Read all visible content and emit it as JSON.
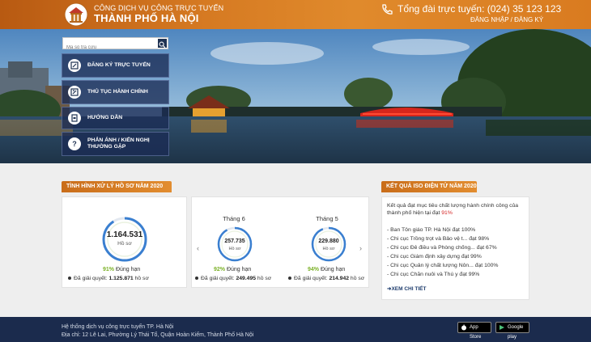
{
  "header": {
    "brand_top": "CÔNG DỊCH VỤ CÔNG TRỰC TUYẾN",
    "brand_main": "THÀNH PHỐ HÀ NỘI",
    "hotline": "Tổng đài trực tuyến: (024) 35 123 123",
    "login": "ĐĂNG NHẬP",
    "separator": " / ",
    "register": "ĐĂNG KÝ"
  },
  "search": {
    "placeholder": "Mã số tra cứu"
  },
  "menu": [
    {
      "label": "ĐĂNG KÝ TRỰC TUYẾN",
      "icon": "register-icon"
    },
    {
      "label": "THỦ TỤC HÀNH CHÍNH",
      "icon": "procedure-icon"
    },
    {
      "label": "HƯỚNG DẪN",
      "icon": "guide-icon"
    },
    {
      "label": "PHẢN ÁNH / KIẾN NGHỊ",
      "label2": "THƯỜNG GẶP",
      "icon": "question-icon"
    }
  ],
  "stats": {
    "title": "TÌNH HÌNH XỬ LÝ HỒ SƠ NĂM 2020",
    "total": {
      "number": "1.164.531",
      "unit": "Hồ sơ",
      "pct": "91%",
      "pct_label": " Đúng hạn",
      "solved_label": "Đã giải quyết: ",
      "solved_value": "1.125.871",
      "solved_unit": " hồ sơ",
      "fill": 0.91
    },
    "months": [
      {
        "label": "Tháng 6",
        "number": "257.735",
        "unit": "Hồ sơ",
        "pct": "92%",
        "pct_label": " Đúng hạn",
        "solved_label": "Đã giải quyết: ",
        "solved_value": "249.495",
        "solved_unit": " hồ sơ",
        "fill": 0.92
      },
      {
        "label": "Tháng 5",
        "number": "229.880",
        "unit": "Hồ sơ",
        "pct": "94%",
        "pct_label": " Đúng hạn",
        "solved_label": "Đã giải quyết: ",
        "solved_value": "214.942",
        "solved_unit": " hồ sơ",
        "fill": 0.94
      }
    ]
  },
  "iso": {
    "title": "KẾT QUẢ ISO ĐIỆN TỬ NĂM 2020",
    "intro": "Kết quả đạt mục tiêu chất lượng hành chính công của thành phố hiện tại đạt ",
    "intro_pct": "91%",
    "items": [
      "- Ban Tôn giáo TP. Hà Nội đạt 100%",
      "- Chi cục Trồng trọt và Bảo vệ t... đạt 98%",
      "- Chi cục Đê điều và Phòng chống... đạt 67%",
      "- Chi cục Giám định xây dựng đạt 99%",
      "- Chi cục Quản lý chất lượng Nôn... đạt 100%",
      "- Chi cục Chăn nuôi và Thú y đạt 99%"
    ],
    "more": "XEM CHI TIẾT"
  },
  "footer": {
    "line1": "Hệ thống dịch vụ công trực tuyến TP. Hà Nội",
    "line2": "Địa chỉ: 12 Lê Lai, Phường Lý Thái Tổ, Quận Hoàn Kiếm, Thành Phố Hà Nội",
    "appstore": "App Store",
    "googleplay": "Google play"
  },
  "colors": {
    "accent": "#e08a2c",
    "navy": "#1b2b4d",
    "ring_blue": "#3a7fd0",
    "ring_green": "#7bb127",
    "alert_red": "#d31f1f"
  }
}
